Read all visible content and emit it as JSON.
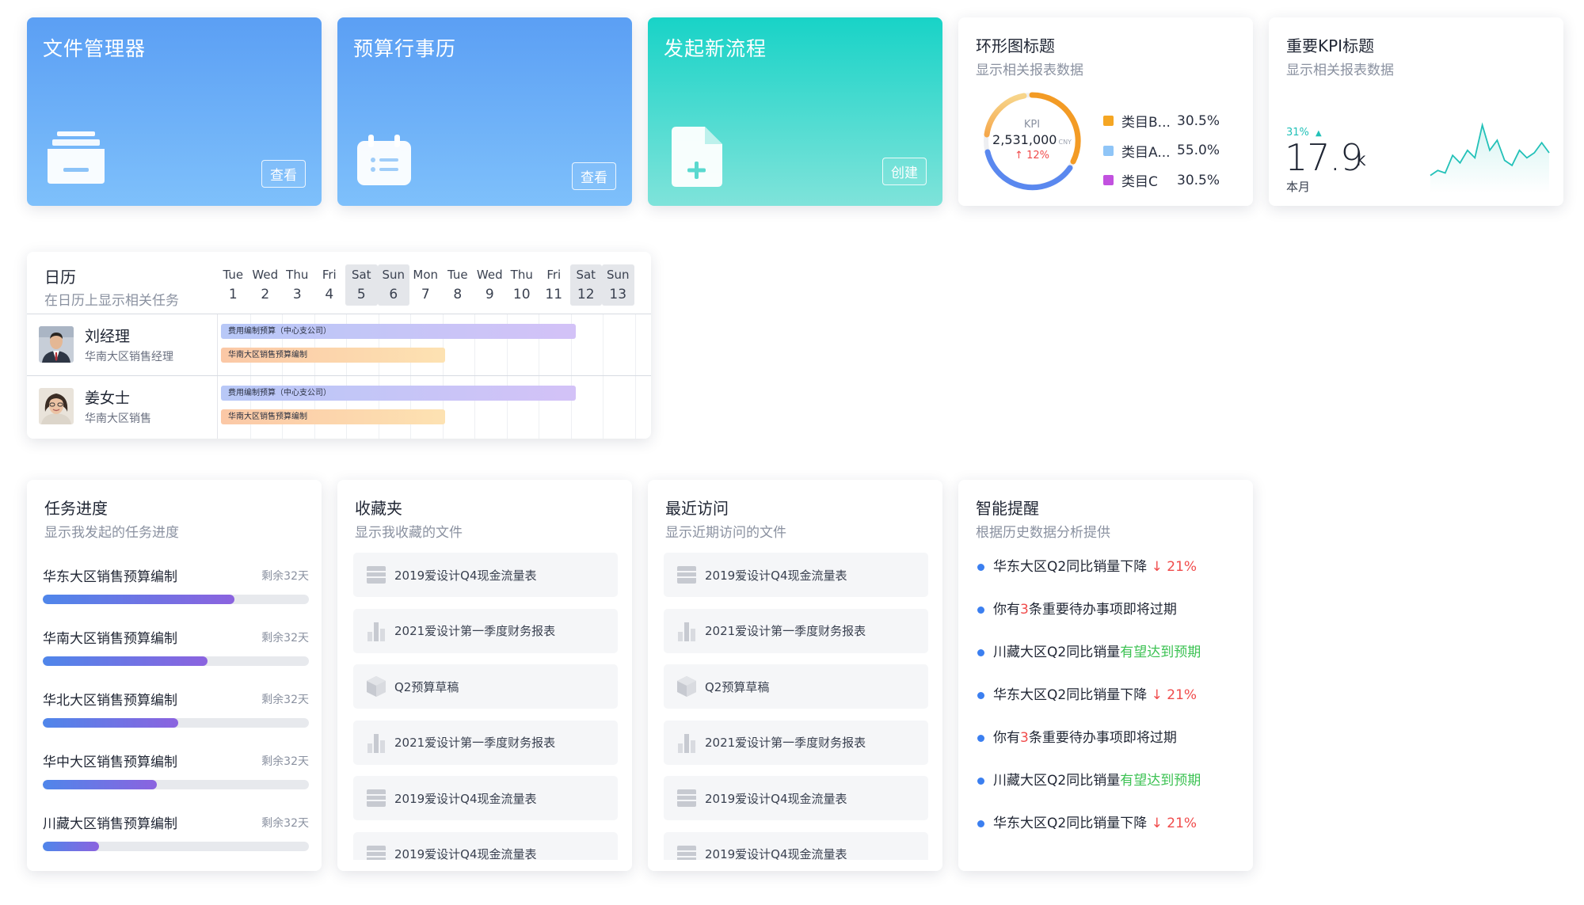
{
  "tiles": [
    {
      "title": "文件管理器",
      "button": "查看",
      "icon": "inbox-tray-icon"
    },
    {
      "title": "预算行事历",
      "button": "查看",
      "icon": "calendar-icon"
    },
    {
      "title": "发起新流程",
      "button": "创建",
      "icon": "new-file-icon"
    }
  ],
  "donut": {
    "title": "环形图标题",
    "subtitle": "显示相关报表数据",
    "center_label": "KPI",
    "center_value": "2,531,000",
    "center_unit": "CNY",
    "center_change": "12%",
    "legend": [
      {
        "name": "类目B...",
        "value": "30.5%",
        "color": "#f5a623"
      },
      {
        "name": "类目A...",
        "value": "55.0%",
        "color": "#8fc5f7"
      },
      {
        "name": "类目C",
        "value": "30.5%",
        "color": "#c251df"
      }
    ],
    "chart_data": {
      "type": "pie",
      "categories": [
        "类目B...",
        "类目A...",
        "类目C"
      ],
      "values": [
        30.5,
        55.0,
        30.5
      ]
    }
  },
  "kpi": {
    "title": "重要KPI标题",
    "subtitle": "显示相关报表数据",
    "change": "31%",
    "value": "17.9",
    "unit": "K",
    "period": "本月",
    "trend": [
      2,
      4,
      3,
      10,
      7,
      12,
      9,
      22,
      12,
      16,
      8,
      6,
      12,
      9,
      11,
      15,
      11
    ]
  },
  "calendar": {
    "title": "日历",
    "subtitle": "在日历上显示相关任务",
    "days": [
      {
        "name": "Tue",
        "num": "1",
        "weekend": false
      },
      {
        "name": "Wed",
        "num": "2",
        "weekend": false
      },
      {
        "name": "Thu",
        "num": "3",
        "weekend": false
      },
      {
        "name": "Fri",
        "num": "4",
        "weekend": false
      },
      {
        "name": "Sat",
        "num": "5",
        "weekend": true
      },
      {
        "name": "Sun",
        "num": "6",
        "weekend": true
      },
      {
        "name": "Mon",
        "num": "7",
        "weekend": false
      },
      {
        "name": "Tue",
        "num": "8",
        "weekend": false
      },
      {
        "name": "Wed",
        "num": "9",
        "weekend": false
      },
      {
        "name": "Thu",
        "num": "10",
        "weekend": false
      },
      {
        "name": "Fri",
        "num": "11",
        "weekend": false
      },
      {
        "name": "Sat",
        "num": "12",
        "weekend": true
      },
      {
        "name": "Sun",
        "num": "13",
        "weekend": true
      }
    ],
    "people": [
      {
        "name": "刘经理",
        "role": "华南大区销售经理",
        "task1": "费用编制预算（中心支公司）",
        "task2": "华南大区销售预算编制"
      },
      {
        "name": "姜女士",
        "role": "华南大区销售",
        "task1": "费用编制预算（中心支公司）",
        "task2": "华南大区销售预算编制"
      }
    ]
  },
  "tasks": {
    "title": "任务进度",
    "subtitle": "显示我发起的任务进度",
    "items": [
      {
        "name": "华东大区销售预算编制",
        "remaining": "剩余32天",
        "progress": 0.72
      },
      {
        "name": "华南大区销售预算编制",
        "remaining": "剩余32天",
        "progress": 0.62
      },
      {
        "name": "华北大区销售预算编制",
        "remaining": "剩余32天",
        "progress": 0.51
      },
      {
        "name": "华中大区销售预算编制",
        "remaining": "剩余32天",
        "progress": 0.43
      },
      {
        "name": "川藏大区销售预算编制",
        "remaining": "剩余32天",
        "progress": 0.21
      }
    ]
  },
  "favorites": {
    "title": "收藏夹",
    "subtitle": "显示我收藏的文件",
    "items": [
      {
        "name": "2019爱设计Q4现金流量表",
        "icon": "table-icon"
      },
      {
        "name": "2021爱设计第一季度财务报表",
        "icon": "bar-chart-icon"
      },
      {
        "name": "Q2预算草稿",
        "icon": "cube-icon"
      },
      {
        "name": "2021爱设计第一季度财务报表",
        "icon": "bar-chart-icon"
      },
      {
        "name": "2019爱设计Q4现金流量表",
        "icon": "table-icon"
      },
      {
        "name": "2019爱设计Q4现金流量表",
        "icon": "table-icon"
      }
    ]
  },
  "recent": {
    "title": "最近访问",
    "subtitle": "显示近期访问的文件",
    "items": [
      {
        "name": "2019爱设计Q4现金流量表",
        "icon": "table-icon"
      },
      {
        "name": "2021爱设计第一季度财务报表",
        "icon": "bar-chart-icon"
      },
      {
        "name": "Q2预算草稿",
        "icon": "cube-icon"
      },
      {
        "name": "2021爱设计第一季度财务报表",
        "icon": "bar-chart-icon"
      },
      {
        "name": "2019爱设计Q4现金流量表",
        "icon": "table-icon"
      },
      {
        "name": "2019爱设计Q4现金流量表",
        "icon": "table-icon"
      }
    ]
  },
  "reminders": {
    "title": "智能提醒",
    "subtitle": "根据历史数据分析提供",
    "items": [
      {
        "pre": "华东大区Q2同比销量下降 ",
        "hl": "↓ 21%",
        "post": "",
        "tone": "red"
      },
      {
        "pre": "你有",
        "hl": "3",
        "post": "条重要待办事项即将过期",
        "tone": "red"
      },
      {
        "pre": "川藏大区Q2同比销量",
        "hl": "有望达到预期",
        "post": "",
        "tone": "green"
      },
      {
        "pre": "华东大区Q2同比销量下降 ",
        "hl": "↓ 21%",
        "post": "",
        "tone": "red"
      },
      {
        "pre": "你有",
        "hl": "3",
        "post": "条重要待办事项即将过期",
        "tone": "red"
      },
      {
        "pre": "川藏大区Q2同比销量",
        "hl": "有望达到预期",
        "post": "",
        "tone": "green"
      },
      {
        "pre": "华东大区Q2同比销量下降 ",
        "hl": "↓ 21%",
        "post": "",
        "tone": "red"
      }
    ]
  }
}
